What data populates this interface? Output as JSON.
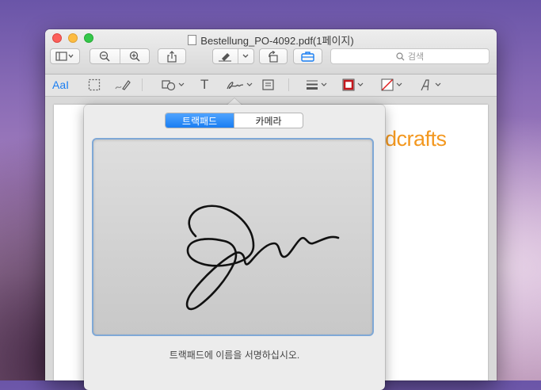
{
  "window": {
    "title": "Bestellung_PO-4092.pdf(1페이지)"
  },
  "toolbar": {
    "search_placeholder": "검색",
    "buttons": [
      {
        "name": "sidebar-view",
        "icon": "sidebar-icon"
      },
      {
        "name": "zoom-out",
        "icon": "zoom-out-icon"
      },
      {
        "name": "zoom-in",
        "icon": "zoom-in-icon"
      },
      {
        "name": "share",
        "icon": "share-icon"
      },
      {
        "name": "highlight",
        "icon": "highlighter-icon"
      },
      {
        "name": "rotate",
        "icon": "rotate-icon"
      },
      {
        "name": "markup-toolbox",
        "icon": "toolbox-icon"
      }
    ]
  },
  "markup": {
    "text_tool_label": "AaI",
    "text_tool": "T"
  },
  "document": {
    "brand_text": "dcrafts"
  },
  "signature_popover": {
    "tabs": [
      {
        "label": "트랙패드",
        "active": true
      },
      {
        "label": "카메라",
        "active": false
      }
    ],
    "instruction": "트랙패드에 이름을 서명하십시오."
  },
  "colors": {
    "accent": "#1a7ef2",
    "brand_orange": "#f39820",
    "pad_border": "#7fa8d6"
  }
}
